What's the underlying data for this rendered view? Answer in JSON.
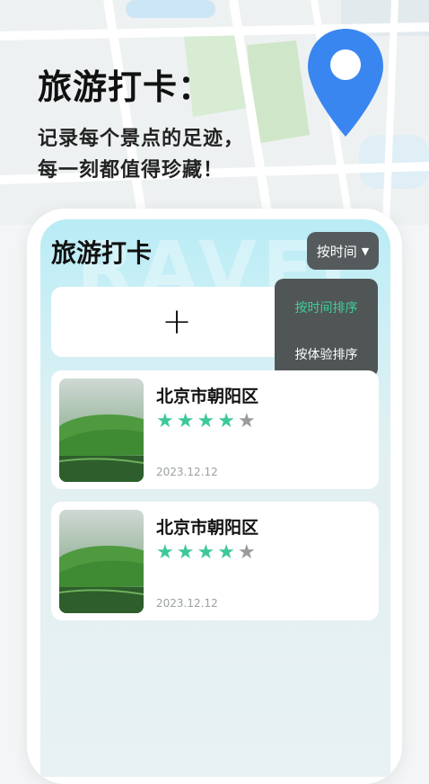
{
  "promo": {
    "headline": "旅游打卡：",
    "subtitle_line1": "记录每个景点的足迹，",
    "subtitle_line2": "每一刻都值得珍藏！"
  },
  "app": {
    "title": "旅游打卡",
    "sort_button": "按时间",
    "add_label": "+",
    "sort_menu": {
      "options": [
        "按时间排序",
        "按体验排序"
      ],
      "selected": "按时间排序"
    }
  },
  "colors": {
    "accent": "#3dc997",
    "pin": "#3a86f0",
    "dropdown_bg": "#505656"
  },
  "entries": [
    {
      "place": "北京市朝阳区",
      "rating": 4,
      "max_rating": 5,
      "date": "2023.12.12"
    },
    {
      "place": "北京市朝阳区",
      "rating": 4,
      "max_rating": 5,
      "date": "2023.12.12"
    }
  ]
}
